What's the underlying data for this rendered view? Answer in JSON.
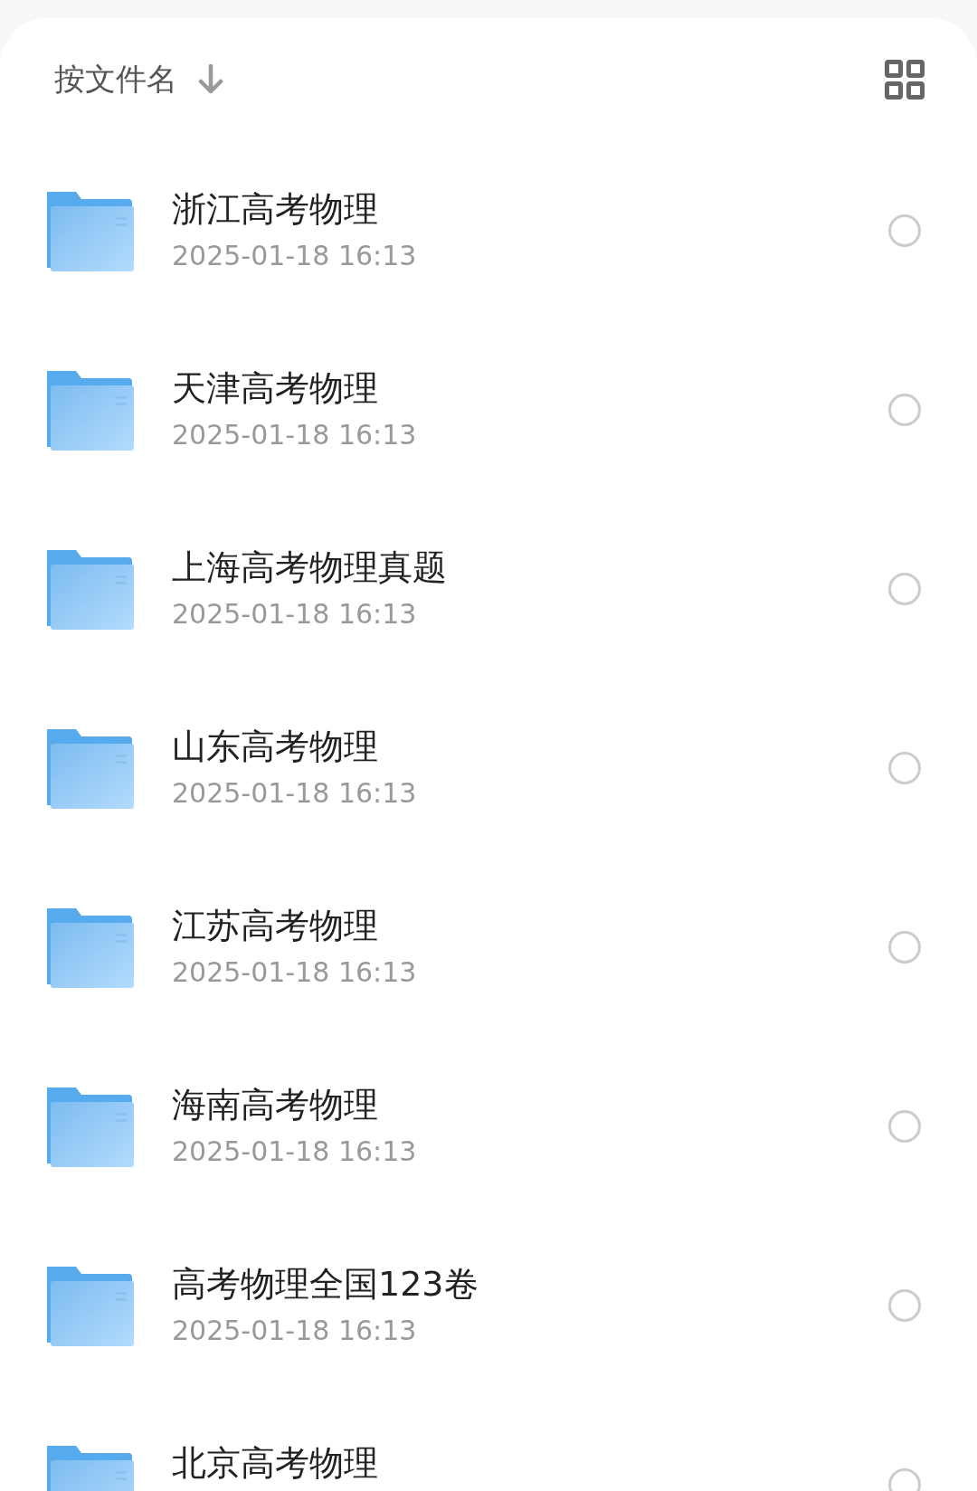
{
  "header": {
    "sort_label": "按文件名"
  },
  "files": [
    {
      "name": "浙江高考物理",
      "date": "2025-01-18 16:13",
      "selected": false
    },
    {
      "name": "天津高考物理",
      "date": "2025-01-18 16:13",
      "selected": false
    },
    {
      "name": "上海高考物理真题",
      "date": "2025-01-18 16:13",
      "selected": false
    },
    {
      "name": "山东高考物理",
      "date": "2025-01-18 16:13",
      "selected": false
    },
    {
      "name": "江苏高考物理",
      "date": "2025-01-18 16:13",
      "selected": false
    },
    {
      "name": "海南高考物理",
      "date": "2025-01-18 16:13",
      "selected": false
    },
    {
      "name": "高考物理全国123卷",
      "date": "2025-01-18 16:13",
      "selected": false
    },
    {
      "name": "北京高考物理",
      "selected": false
    }
  ]
}
